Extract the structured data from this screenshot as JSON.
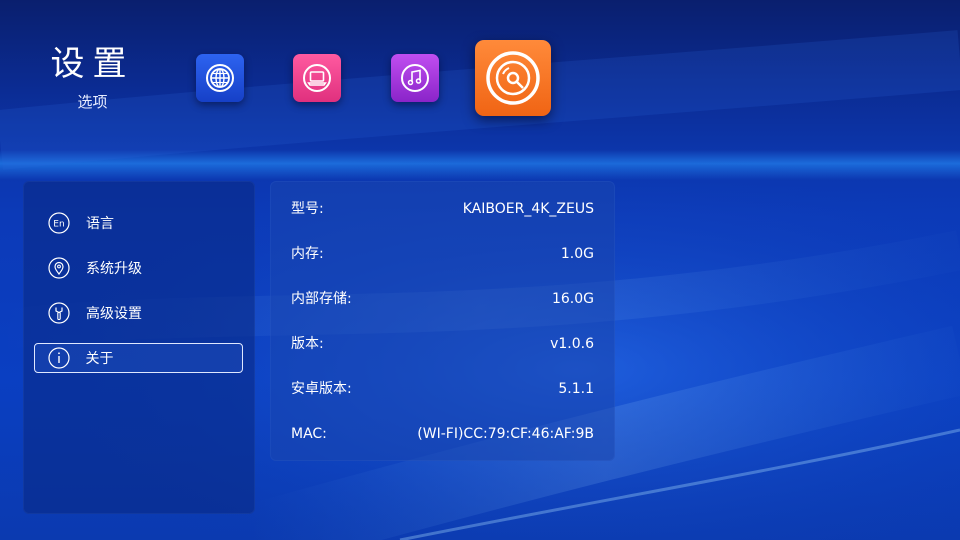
{
  "header": {
    "title": "设置",
    "subtitle": "选项"
  },
  "apps": [
    {
      "icon": "globe-icon",
      "color": "#2d63f0"
    },
    {
      "icon": "laptop-icon",
      "color": "#e0307e"
    },
    {
      "icon": "music-icon",
      "color": "#8a24c9"
    },
    {
      "icon": "disc-icon",
      "color": "#f06414",
      "active": true
    }
  ],
  "sidebar": {
    "items": [
      {
        "label": "语言",
        "icon": "language-en-icon",
        "selected": false
      },
      {
        "label": "系统升级",
        "icon": "location-pin-icon",
        "selected": false
      },
      {
        "label": "高级设置",
        "icon": "wrench-icon",
        "selected": false
      },
      {
        "label": "关于",
        "icon": "info-icon",
        "selected": true
      }
    ]
  },
  "about": {
    "rows": [
      {
        "key": "型号:",
        "value": "KAIBOER_4K_ZEUS"
      },
      {
        "key": "内存:",
        "value": "1.0G"
      },
      {
        "key": "内部存储:",
        "value": "16.0G"
      },
      {
        "key": "版本:",
        "value": "v1.0.6"
      },
      {
        "key": "安卓版本:",
        "value": "5.1.1"
      },
      {
        "key": "MAC:",
        "value": "(WI-FI)CC:79:CF:46:AF:9B"
      }
    ]
  },
  "colors": {
    "background": "#0b3ab0",
    "panel": "#0a2882",
    "accent_active": "#f06414"
  }
}
